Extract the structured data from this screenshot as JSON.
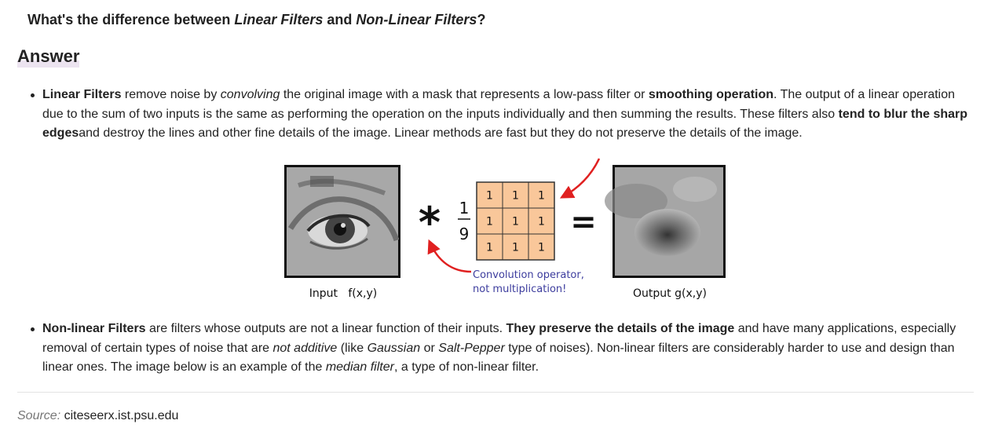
{
  "question": {
    "prefix": "What's the difference between ",
    "term1": "Linear Filters",
    "middle": " and ",
    "term2": "Non-Linear Filters",
    "suffix": "?"
  },
  "answer_heading": "Answer",
  "bullet1": {
    "t1": "Linear Filters",
    "t2": " remove noise by ",
    "t3": "convolving",
    "t4": " the original image with a mask that represents a low-pass filter or ",
    "t5": "smoothing operation",
    "t6": ". The output of a linear operation due to the sum of two inputs is the same as performing the operation on the inputs individually and then summing the results. These filters also ",
    "t7": "tend to blur the sharp edges",
    "t8": "and destroy the lines and other fine details of the image. Linear methods are fast but they do not preserve the details of the image."
  },
  "figure": {
    "input_label": "Input   f(x,y)",
    "output_label": "Output g(x,y)",
    "operator_symbol": "*",
    "fraction_numerator": "1",
    "fraction_denominator": "9",
    "kernel": [
      [
        "1",
        "1",
        "1"
      ],
      [
        "1",
        "1",
        "1"
      ],
      [
        "1",
        "1",
        "1"
      ]
    ],
    "equals_symbol": "=",
    "annotation_line1": "Convolution operator,",
    "annotation_line2": "not multiplication!",
    "kernel_color": "#f9c79a",
    "arrow_color": "#e02020",
    "annotation_color": "#3d3d9e"
  },
  "bullet2": {
    "t1": "Non-linear Filters",
    "t2": " are filters whose outputs are not a linear function of their inputs. ",
    "t3": "They preserve the details of the image",
    "t4": " and have many applications, especially removal of certain types of noise that are ",
    "t5": "not additive",
    "t6": " (like ",
    "t7": "Gaussian",
    "t8": " or ",
    "t9": "Salt-Pepper",
    "t10": " type of noises). Non-linear filters are considerably harder to use and design than linear ones. The image below is an example of the ",
    "t11": "median filter",
    "t12": ", a type of non-linear filter."
  },
  "source": {
    "label": "Source:",
    "text": " citeseerx.ist.psu.edu"
  }
}
